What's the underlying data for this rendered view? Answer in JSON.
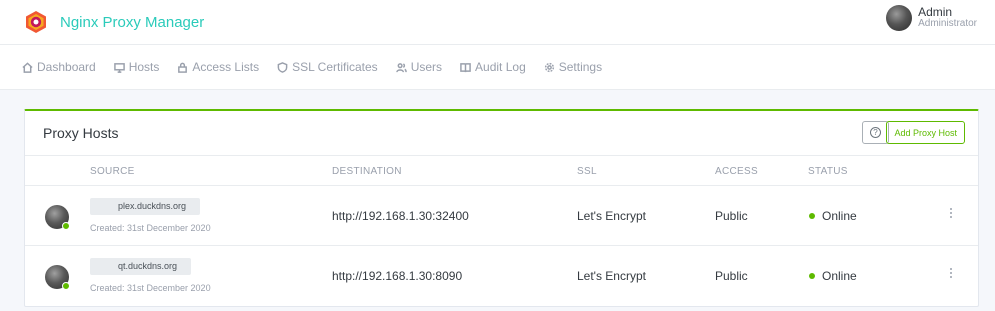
{
  "app": {
    "name": "Nginx Proxy Manager"
  },
  "user": {
    "name": "Admin",
    "role": "Administrator"
  },
  "nav": [
    {
      "label": "Dashboard",
      "icon": "home-icon"
    },
    {
      "label": "Hosts",
      "icon": "monitor-icon"
    },
    {
      "label": "Access Lists",
      "icon": "lock-icon"
    },
    {
      "label": "SSL Certificates",
      "icon": "shield-icon"
    },
    {
      "label": "Users",
      "icon": "users-icon"
    },
    {
      "label": "Audit Log",
      "icon": "book-icon"
    },
    {
      "label": "Settings",
      "icon": "gear-icon"
    }
  ],
  "card": {
    "title": "Proxy Hosts",
    "help_label": "?",
    "add_label": "Add Proxy Host"
  },
  "table": {
    "headers": [
      "SOURCE",
      "DESTINATION",
      "SSL",
      "ACCESS",
      "STATUS"
    ],
    "rows": [
      {
        "domain": "plex.duckdns.org",
        "created": "Created: 31st December 2020",
        "destination": "http://192.168.1.30:32400",
        "ssl": "Let's Encrypt",
        "access": "Public",
        "status": "Online"
      },
      {
        "domain": "qt.duckdns.org",
        "created": "Created: 31st December 2020",
        "destination": "http://192.168.1.30:8090",
        "ssl": "Let's Encrypt",
        "access": "Public",
        "status": "Online"
      }
    ]
  },
  "colors": {
    "brand": "#2bcbba",
    "accent": "#5eba00",
    "muted": "#9aa0ac"
  }
}
